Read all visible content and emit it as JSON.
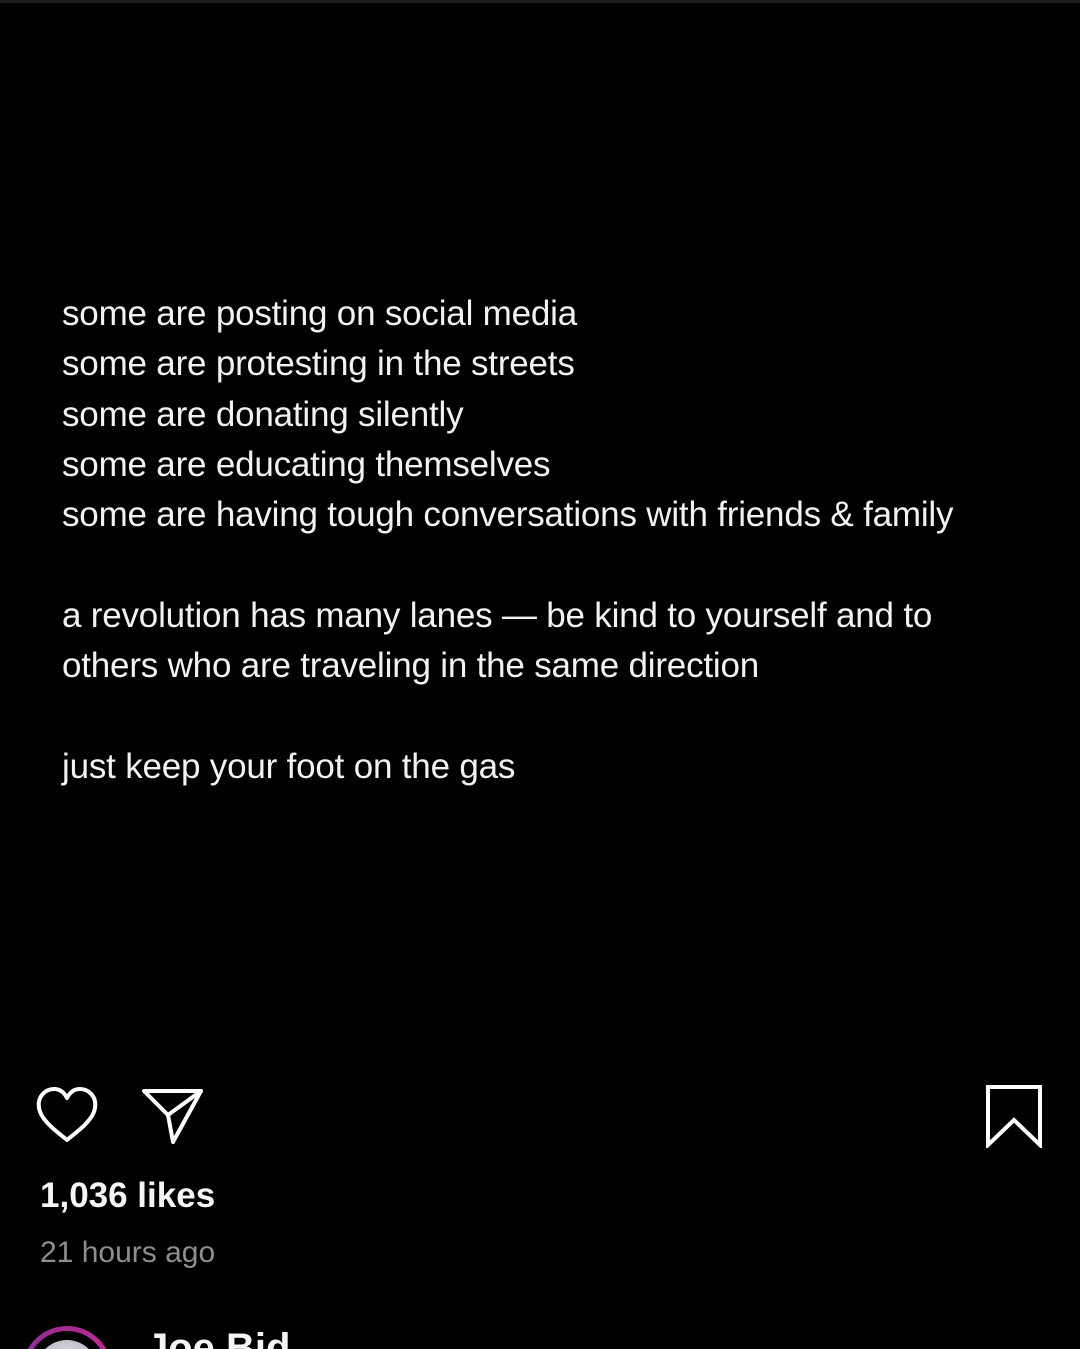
{
  "post": {
    "lines": [
      "some are posting on social media",
      "some are protesting in the streets",
      "some are donating silently",
      "some are educating themselves",
      "some are having tough conversations with friends & family",
      "a revolution has many lanes — be kind to yourself and to",
      "others who are traveling in the same direction",
      "just keep your foot on the gas"
    ]
  },
  "actions": {
    "like_icon": "heart-icon",
    "share_icon": "paper-plane-icon",
    "save_icon": "bookmark-icon"
  },
  "stats": {
    "likes": "1,036 likes",
    "time": "21 hours ago"
  },
  "author": {
    "name_partial": "Joe Bid"
  },
  "colors": {
    "background": "#000000",
    "text": "#f2f2f2",
    "muted": "#8e8e8e",
    "story_ring": "#a62c8f"
  }
}
